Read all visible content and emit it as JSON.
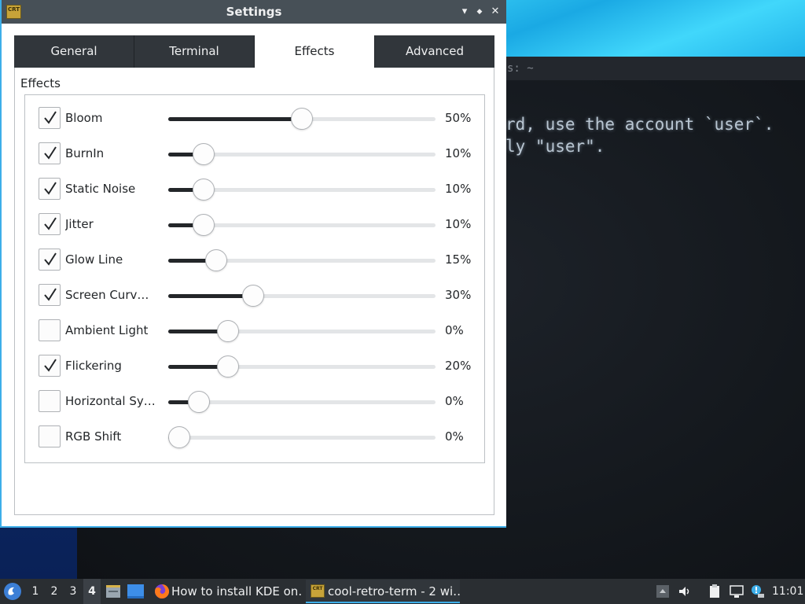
{
  "dialog": {
    "title": "Settings",
    "app_icon_text": "CRT",
    "controls": {
      "minimize": "▾",
      "maximize": "◆",
      "close": "✕"
    }
  },
  "tabs": [
    {
      "label": "General",
      "active": false
    },
    {
      "label": "Terminal",
      "active": false
    },
    {
      "label": "Effects",
      "active": true
    },
    {
      "label": "Advanced",
      "active": false
    }
  ],
  "effects": {
    "group_title": "Effects",
    "rows": [
      {
        "label": "Bloom",
        "checked": true,
        "value": 0.5,
        "display": "50%"
      },
      {
        "label": "BurnIn",
        "checked": true,
        "value": 0.1,
        "display": "10%"
      },
      {
        "label": "Static Noise",
        "checked": true,
        "value": 0.1,
        "display": "10%"
      },
      {
        "label": "Jitter",
        "checked": true,
        "value": 0.1,
        "display": "10%"
      },
      {
        "label": "Glow Line",
        "checked": true,
        "value": 0.15,
        "display": "15%"
      },
      {
        "label": "Screen Curvat…",
        "checked": true,
        "value": 0.3,
        "display": "30%"
      },
      {
        "label": "Ambient Light",
        "checked": false,
        "value": 0.2,
        "display": "0%"
      },
      {
        "label": "Flickering",
        "checked": true,
        "value": 0.2,
        "display": "20%"
      },
      {
        "label": "Horizontal Sync",
        "checked": false,
        "value": 0.08,
        "display": "0%"
      },
      {
        "label": "RGB Shift",
        "checked": false,
        "value": 0.0,
        "display": "0%"
      }
    ]
  },
  "terminal": {
    "titlebar_text": "s: ~",
    "lines": [
      "rd, use the account `user`.",
      "ly \"user\"."
    ]
  },
  "taskbar": {
    "desktops": [
      "1",
      "2",
      "3",
      "4"
    ],
    "active_desktop": "4",
    "tasks": [
      {
        "label": "How to install KDE on…",
        "icon": "firefox-icon",
        "active": false
      },
      {
        "label": "cool-retro-term - 2 wi…",
        "icon": "crt-icon",
        "active": true
      }
    ],
    "clock": "11:01"
  }
}
